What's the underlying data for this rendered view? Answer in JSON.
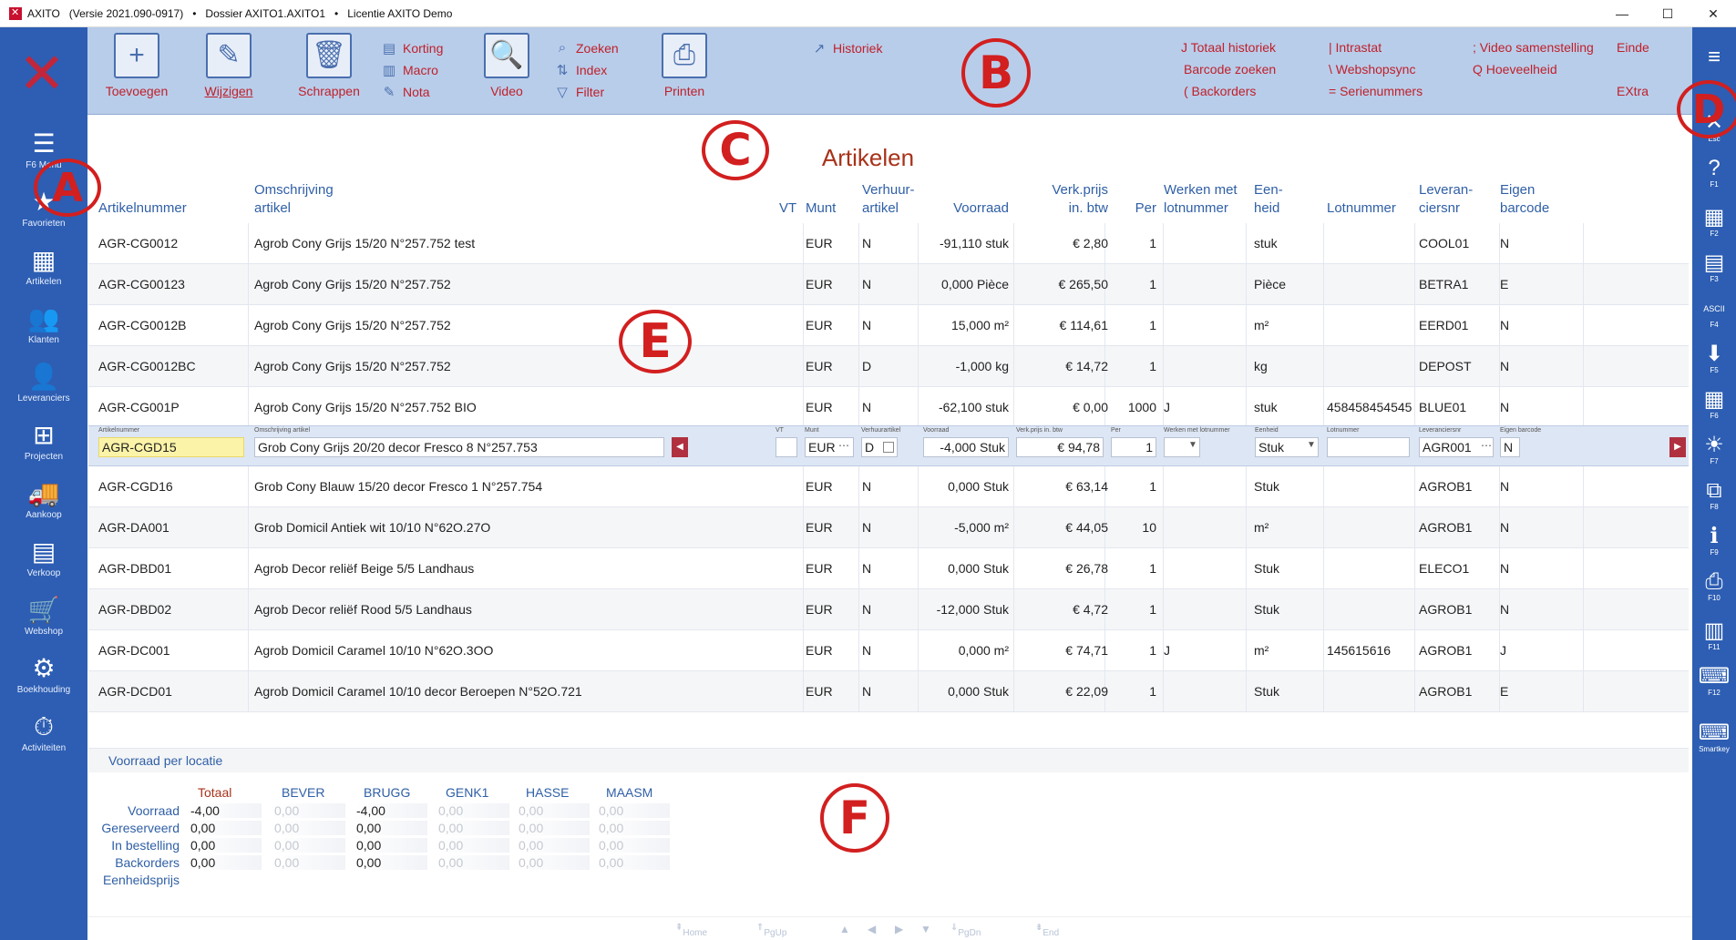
{
  "titlebar": {
    "app": "AXITO",
    "version": "(Versie 2021.090-0917)",
    "dossier": "Dossier AXITO1.AXITO1",
    "license": "Licentie AXITO Demo",
    "sep": "•"
  },
  "window_controls": {
    "minimize": "—",
    "maximize": "☐",
    "close": "✕"
  },
  "sidebar": {
    "items": [
      {
        "label": "F6 Menu",
        "icon": "menu-icon",
        "glyph": "☰"
      },
      {
        "label": "Favorieten",
        "icon": "star-icon",
        "glyph": "★"
      },
      {
        "label": "Artikelen",
        "icon": "qr-icon",
        "glyph": "▦"
      },
      {
        "label": "Klanten",
        "icon": "group-icon",
        "glyph": "👥"
      },
      {
        "label": "Leveranciers",
        "icon": "person-icon",
        "glyph": "👤"
      },
      {
        "label": "Projecten",
        "icon": "hierarchy-icon",
        "glyph": "⊞"
      },
      {
        "label": "Aankoop",
        "icon": "truck-icon",
        "glyph": "🚚"
      },
      {
        "label": "Verkoop",
        "icon": "document-icon",
        "glyph": "▤"
      },
      {
        "label": "Webshop",
        "icon": "cart-icon",
        "glyph": "🛒"
      },
      {
        "label": "Boekhouding",
        "icon": "coins-icon",
        "glyph": "⚙"
      },
      {
        "label": "Activiteiten",
        "icon": "stopwatch-icon",
        "glyph": "⏱"
      }
    ]
  },
  "rightbar": {
    "items": [
      {
        "label": "",
        "glyph": "≡",
        "icon": "hamburger-icon"
      },
      {
        "label": "Esc",
        "glyph": "✕",
        "icon": "close-icon"
      },
      {
        "label": "F1",
        "glyph": "?",
        "icon": "help-icon"
      },
      {
        "label": "F2",
        "glyph": "▦",
        "icon": "calendar-icon"
      },
      {
        "label": "F3",
        "glyph": "▤",
        "icon": "calculator-icon"
      },
      {
        "label": "F4",
        "glyph": "ASCII",
        "icon": "ascii-icon"
      },
      {
        "label": "F5",
        "glyph": "⬇",
        "icon": "download-icon"
      },
      {
        "label": "F6",
        "glyph": "▦",
        "icon": "grid-icon"
      },
      {
        "label": "F7",
        "glyph": "☀",
        "icon": "lightbulb-icon"
      },
      {
        "label": "F8",
        "glyph": "⧉",
        "icon": "windows-icon"
      },
      {
        "label": "F9",
        "glyph": "ℹ",
        "icon": "info-icon"
      },
      {
        "label": "F10",
        "glyph": "⎙",
        "icon": "print-icon"
      },
      {
        "label": "F11",
        "glyph": "▥",
        "icon": "chart-icon"
      },
      {
        "label": "F12",
        "glyph": "⌨",
        "icon": "keyboard-icon"
      },
      {
        "label": "Smartkey",
        "glyph": "⌨",
        "icon": "smartkey-icon"
      }
    ]
  },
  "toolbar": {
    "toevoegen": "Toevoegen",
    "wijzigen": "Wijzigen",
    "schrappen": "Schrappen",
    "korting": "Korting",
    "macro": "Macro",
    "nota": "Nota",
    "video": "Video",
    "zoeken": "Zoeken",
    "index": "Index",
    "filter": "Filter",
    "printen": "Printen",
    "historiek": "Historiek",
    "totaal_historiek": "J Totaal historiek",
    "barcode_zoeken": "Barcode zoeken",
    "backorders": "( Backorders",
    "intrastat": "| Intrastat",
    "webshopsync": "\\ Webshopsync",
    "serienummers": "= Serienummers",
    "video_samenstelling": "; Video samenstelling",
    "hoeveelheid": "Q Hoeveelheid",
    "einde": "Einde",
    "extra": "EXtra"
  },
  "annotations": {
    "a": "A",
    "b": "B",
    "c": "C",
    "d": "D",
    "e": "E",
    "f": "F"
  },
  "page": {
    "title": "Artikelen"
  },
  "columns": {
    "artikelnummer": "Artikelnummer",
    "omschrijving_1": "Omschrijving",
    "omschrijving_2": "artikel",
    "vt": "VT",
    "munt": "Munt",
    "verhuur_1": "Verhuur-",
    "verhuur_2": "artikel",
    "voorraad": "Voorraad",
    "verkprijs_1": "Verk.prijs",
    "verkprijs_2": "in. btw",
    "per": "Per",
    "werken_1": "Werken met",
    "werken_2": "lotnummer",
    "eenheid_1": "Een-",
    "eenheid_2": "heid",
    "lotnummer": "Lotnummer",
    "leverancier_1": "Leveran-",
    "leverancier_2": "ciersnr",
    "barcode_1": "Eigen",
    "barcode_2": "barcode"
  },
  "rows_before": [
    {
      "nr": "AGR-CG0012",
      "oms": "Agrob Cony Grijs 15/20 N°257.752 test",
      "vt": "",
      "munt": "EUR",
      "verhuur": "N",
      "voorraad": "-91,110 stuk",
      "prijs": "€ 2,80",
      "per": "1",
      "werken": "",
      "eenheid": "stuk",
      "lot": "",
      "lev": "COOL01",
      "barcode": "N"
    },
    {
      "nr": "AGR-CG00123",
      "oms": "Agrob Cony Grijs 15/20 N°257.752",
      "vt": "",
      "munt": "EUR",
      "verhuur": "N",
      "voorraad": "0,000 Pièce",
      "prijs": "€ 265,50",
      "per": "1",
      "werken": "",
      "eenheid": "Pièce",
      "lot": "",
      "lev": "BETRA1",
      "barcode": "E"
    },
    {
      "nr": "AGR-CG0012B",
      "oms": "Agrob Cony Grijs 15/20 N°257.752",
      "vt": "",
      "munt": "EUR",
      "verhuur": "N",
      "voorraad": "15,000 m²",
      "prijs": "€ 114,61",
      "per": "1",
      "werken": "",
      "eenheid": "m²",
      "lot": "",
      "lev": "EERD01",
      "barcode": "N"
    },
    {
      "nr": "AGR-CG0012BC",
      "oms": "Agrob Cony Grijs 15/20 N°257.752",
      "vt": "",
      "munt": "EUR",
      "verhuur": "D",
      "voorraad": "-1,000 kg",
      "prijs": "€ 14,72",
      "per": "1",
      "werken": "",
      "eenheid": "kg",
      "lot": "",
      "lev": "DEPOST",
      "barcode": "N"
    },
    {
      "nr": "AGR-CG001P",
      "oms": "Agrob Cony Grijs 15/20 N°257.752 BIO",
      "vt": "",
      "munt": "EUR",
      "verhuur": "N",
      "voorraad": "-62,100 stuk",
      "prijs": "€ 0,00",
      "per": "1000",
      "werken": "J",
      "eenheid": "stuk",
      "lot": "458458454545",
      "lev": "BLUE01",
      "barcode": "N"
    }
  ],
  "edit_row": {
    "labels": {
      "nr": "Artikelnummer",
      "oms": "Omschrijving artikel",
      "vt": "VT",
      "munt": "Munt",
      "verhuur": "Verhuurartikel",
      "voorraad": "Voorraad",
      "prijs": "Verk.prijs in. btw",
      "per": "Per",
      "werken": "Werken met lotnummer",
      "eenheid": "Eenheid",
      "lot": "Lotnummer",
      "lev": "Leveranciersnr",
      "barcode": "Eigen barcode"
    },
    "values": {
      "nr": "AGR-CGD15",
      "oms": "Grob Cony Grijs 20/20 decor Fresco 8 N°257.753",
      "vt": "",
      "munt": "EUR",
      "verhuur": "D",
      "voorraad": "-4,000 Stuk",
      "prijs": "€ 94,78",
      "per": "1",
      "werken": "",
      "eenheid": "Stuk",
      "lot": "",
      "lev": "AGR001",
      "barcode": "N"
    }
  },
  "rows_after": [
    {
      "nr": "AGR-CGD16",
      "oms": "Grob Cony Blauw 15/20 decor Fresco 1 N°257.754",
      "vt": "",
      "munt": "EUR",
      "verhuur": "N",
      "voorraad": "0,000 Stuk",
      "prijs": "€ 63,14",
      "per": "1",
      "werken": "",
      "eenheid": "Stuk",
      "lot": "",
      "lev": "AGROB1",
      "barcode": "N"
    },
    {
      "nr": "AGR-DA001",
      "oms": "Grob Domicil Antiek wit 10/10 N°62O.27O",
      "vt": "",
      "munt": "EUR",
      "verhuur": "N",
      "voorraad": "-5,000 m²",
      "prijs": "€ 44,05",
      "per": "10",
      "werken": "",
      "eenheid": "m²",
      "lot": "",
      "lev": "AGROB1",
      "barcode": "N"
    },
    {
      "nr": "AGR-DBD01",
      "oms": "Agrob Decor reliëf Beige 5/5 Landhaus",
      "vt": "",
      "munt": "EUR",
      "verhuur": "N",
      "voorraad": "0,000 Stuk",
      "prijs": "€ 26,78",
      "per": "1",
      "werken": "",
      "eenheid": "Stuk",
      "lot": "",
      "lev": "ELECO1",
      "barcode": "N"
    },
    {
      "nr": "AGR-DBD02",
      "oms": "Agrob Decor reliëf Rood 5/5 Landhaus",
      "vt": "",
      "munt": "EUR",
      "verhuur": "N",
      "voorraad": "-12,000 Stuk",
      "prijs": "€ 4,72",
      "per": "1",
      "werken": "",
      "eenheid": "Stuk",
      "lot": "",
      "lev": "AGROB1",
      "barcode": "N"
    },
    {
      "nr": "AGR-DC001",
      "oms": "Agrob Domicil Caramel 10/10 N°62O.3OO",
      "vt": "",
      "munt": "EUR",
      "verhuur": "N",
      "voorraad": "0,000 m²",
      "prijs": "€ 74,71",
      "per": "1",
      "werken": "J",
      "eenheid": "m²",
      "lot": "145615616",
      "lev": "AGROB1",
      "barcode": "J"
    },
    {
      "nr": "AGR-DCD01",
      "oms": "Agrob Domicil Caramel 10/10 decor Beroepen N°52O.721",
      "vt": "",
      "munt": "EUR",
      "verhuur": "N",
      "voorraad": "0,000 Stuk",
      "prijs": "€ 22,09",
      "per": "1",
      "werken": "",
      "eenheid": "Stuk",
      "lot": "",
      "lev": "AGROB1",
      "barcode": "E"
    }
  ],
  "location_panel": {
    "header": "Voorraad per locatie",
    "columns": [
      "Totaal",
      "BEVER",
      "BRUGG",
      "GENK1",
      "HASSE",
      "MAASM"
    ],
    "rows": [
      {
        "label": "Voorraad",
        "values": [
          "-4,00",
          "0,00",
          "-4,00",
          "0,00",
          "0,00",
          "0,00"
        ]
      },
      {
        "label": "Gereserveerd",
        "values": [
          "0,00",
          "0,00",
          "0,00",
          "0,00",
          "0,00",
          "0,00"
        ]
      },
      {
        "label": "In bestelling",
        "values": [
          "0,00",
          "0,00",
          "0,00",
          "0,00",
          "0,00",
          "0,00"
        ]
      },
      {
        "label": "Backorders",
        "values": [
          "0,00",
          "0,00",
          "0,00",
          "0,00",
          "0,00",
          "0,00"
        ]
      },
      {
        "label": "Eenheidsprijs",
        "values": []
      }
    ]
  },
  "pager": {
    "home": "Home",
    "pgup": "PgUp",
    "pgdn": "PgDn",
    "end": "End"
  },
  "colors": {
    "brand_blue": "#2d5eb3",
    "toolbar": "#b8cdea",
    "accent_red": "#c0202a",
    "header_blue": "#2f5fa6",
    "annotation": "#d21f1f"
  }
}
